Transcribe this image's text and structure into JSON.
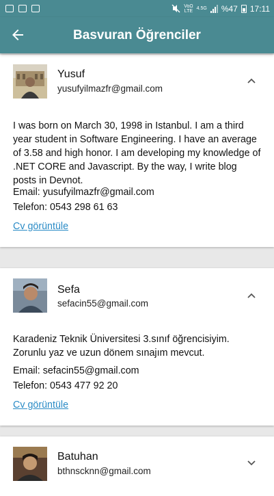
{
  "status_bar": {
    "battery": "%47",
    "time": "17:11",
    "net_top": "VoΩ",
    "net_bottom": "LTE",
    "gen": "4.5G"
  },
  "app_bar": {
    "title": "Basvuran Öğrenciler"
  },
  "students": [
    {
      "name": "Yusuf",
      "email": "yusufyilmazfr@gmail.com",
      "bio": "I was born on March 30, 1998 in Istanbul. I am a third year student in Software Engineering. I have an average of 3.58 and high honor. I am developing my knowledge of .NET CORE and Javascript. By the way, I write blog posts in Devnot.",
      "email_line": "Email: yusufyilmazfr@gmail.com",
      "phone_line": "Telefon: 0543 298 61 63",
      "cv_link": "Cv görüntüle",
      "expanded": true
    },
    {
      "name": "Sefa",
      "email": "sefacin55@gmail.com",
      "bio": "Karadeniz Teknik Üniversitesi 3.sınıf öğrencisiyim. Zorunlu yaz ve uzun dönem sınajım mevcut.",
      "email_line": "Email: sefacin55@gmail.com",
      "phone_line": "Telefon: 0543 477 92 20",
      "cv_link": "Cv görüntüle",
      "expanded": true
    },
    {
      "name": "Batuhan",
      "email": "bthnscknn@gmail.com",
      "expanded": false
    }
  ]
}
